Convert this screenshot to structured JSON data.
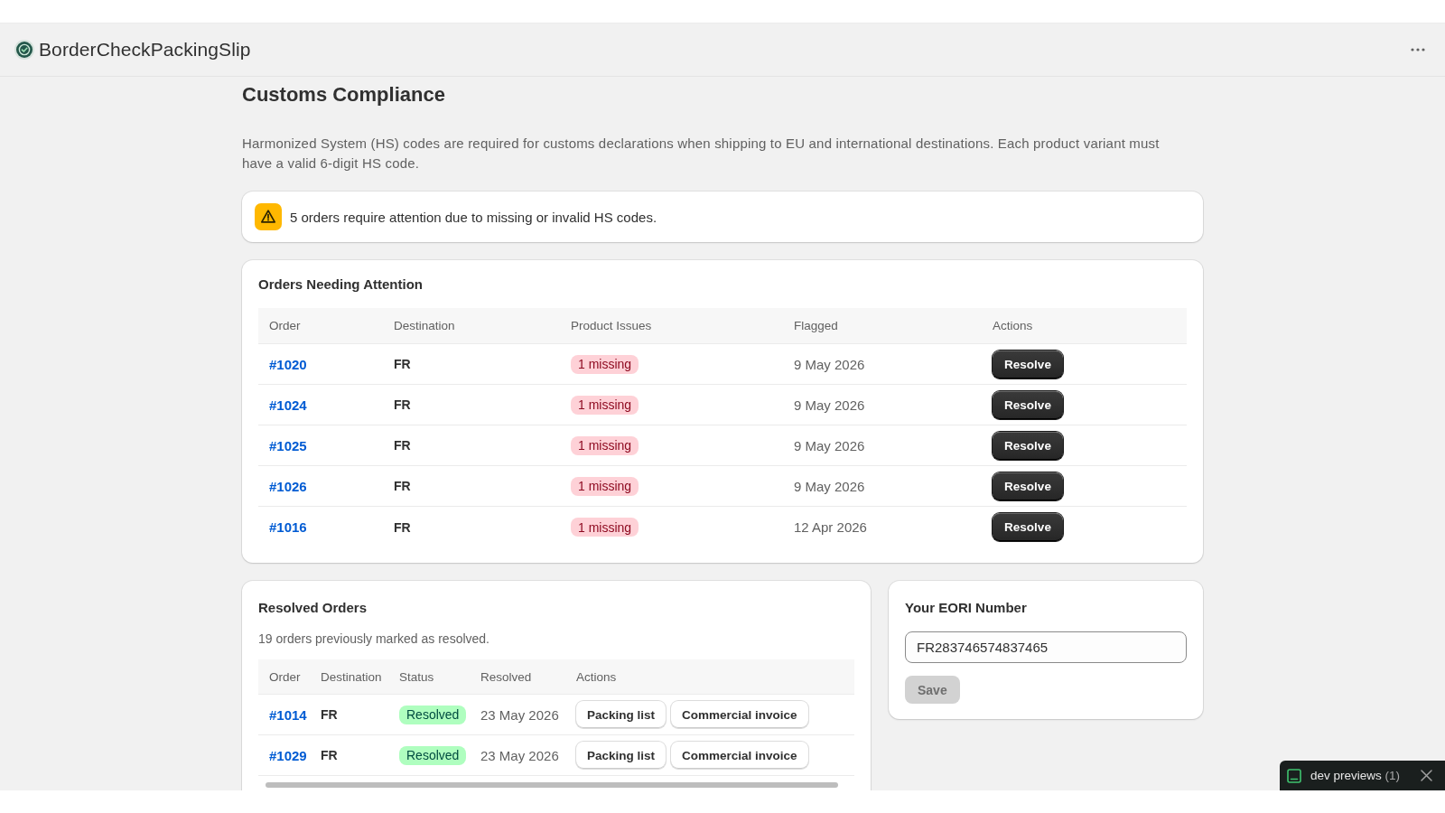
{
  "app_bar": {
    "title": "BorderCheckPackingSlip"
  },
  "page": {
    "title": "Customs Compliance",
    "description": "Harmonized System (HS) codes are required for customs declarations when shipping to EU and international destinations. Each product variant must have a valid 6-digit HS code."
  },
  "alert": {
    "message": "5 orders require attention due to missing or invalid HS codes."
  },
  "orders_needing_attention": {
    "title": "Orders Needing Attention",
    "columns": [
      "Order",
      "Destination",
      "Product Issues",
      "Flagged",
      "Actions"
    ],
    "rows": [
      {
        "order": "#1020",
        "destination": "FR",
        "issues": "1 missing",
        "flagged": "9 May 2026",
        "action": "Resolve"
      },
      {
        "order": "#1024",
        "destination": "FR",
        "issues": "1 missing",
        "flagged": "9 May 2026",
        "action": "Resolve"
      },
      {
        "order": "#1025",
        "destination": "FR",
        "issues": "1 missing",
        "flagged": "9 May 2026",
        "action": "Resolve"
      },
      {
        "order": "#1026",
        "destination": "FR",
        "issues": "1 missing",
        "flagged": "9 May 2026",
        "action": "Resolve"
      },
      {
        "order": "#1016",
        "destination": "FR",
        "issues": "1 missing",
        "flagged": "12 Apr 2026",
        "action": "Resolve"
      }
    ]
  },
  "resolved_orders": {
    "title": "Resolved Orders",
    "summary": "19 orders previously marked as resolved.",
    "columns": [
      "Order",
      "Destination",
      "Status",
      "Resolved",
      "Actions"
    ],
    "rows": [
      {
        "order": "#1014",
        "destination": "FR",
        "status": "Resolved",
        "resolved": "23 May 2026",
        "actions": [
          "Packing list",
          "Commercial invoice"
        ]
      },
      {
        "order": "#1029",
        "destination": "FR",
        "status": "Resolved",
        "resolved": "23 May 2026",
        "actions": [
          "Packing list",
          "Commercial invoice"
        ]
      }
    ]
  },
  "eori": {
    "title": "Your EORI Number",
    "value": "FR283746574837465",
    "save_button": {
      "label": "Save",
      "disabled": true
    }
  },
  "dev_previews": {
    "label": "dev previews",
    "count": "(1)"
  }
}
